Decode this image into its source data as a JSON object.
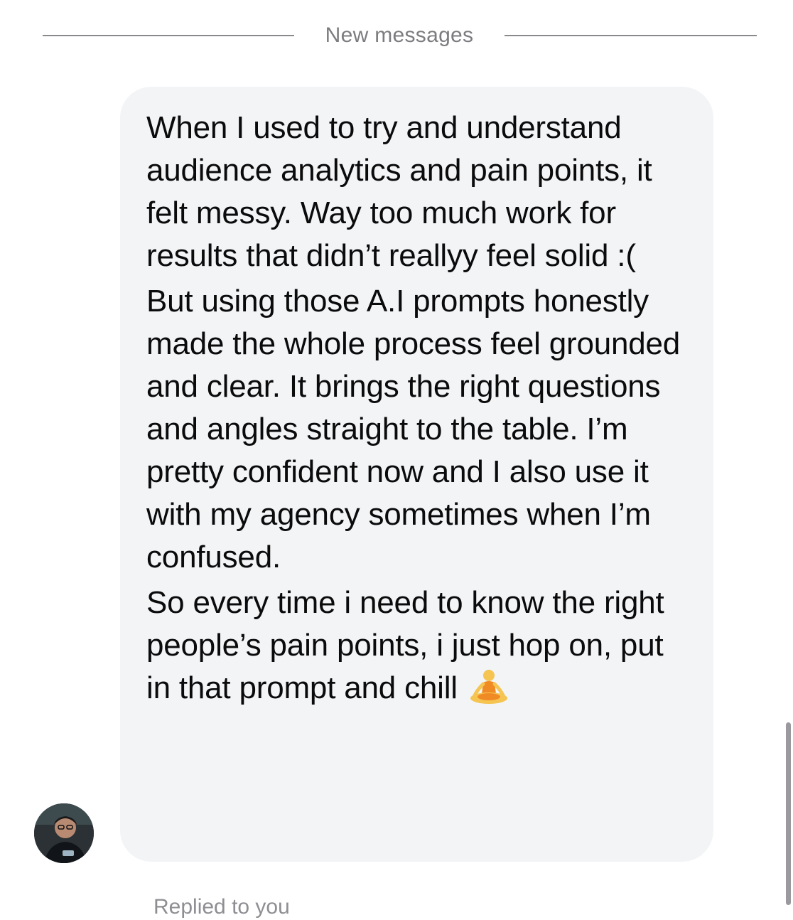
{
  "divider": {
    "label": "New messages"
  },
  "message": {
    "paragraphs": [
      "When I used to try and understand audience analytics and pain points, it felt messy. Way too much work for results that didn’t reallyy feel solid :(",
      "But using those A.I prompts honestly made the whole process feel grounded and clear. It brings the right questions and angles straight to the table. I’m pretty confident now and I also use it with my agency sometimes when I’m confused.",
      "So every time i need to know the right people’s pain points, i just hop on, put in that prompt and chill"
    ],
    "emoji": "person-in-lotus-position-icon"
  },
  "footer": {
    "replied_label": "Replied to you"
  },
  "colors": {
    "bubble": "#f2f4f6",
    "text": "#0b0b0c",
    "divider": "#8a8a8e",
    "muted": "#7c7c80"
  }
}
